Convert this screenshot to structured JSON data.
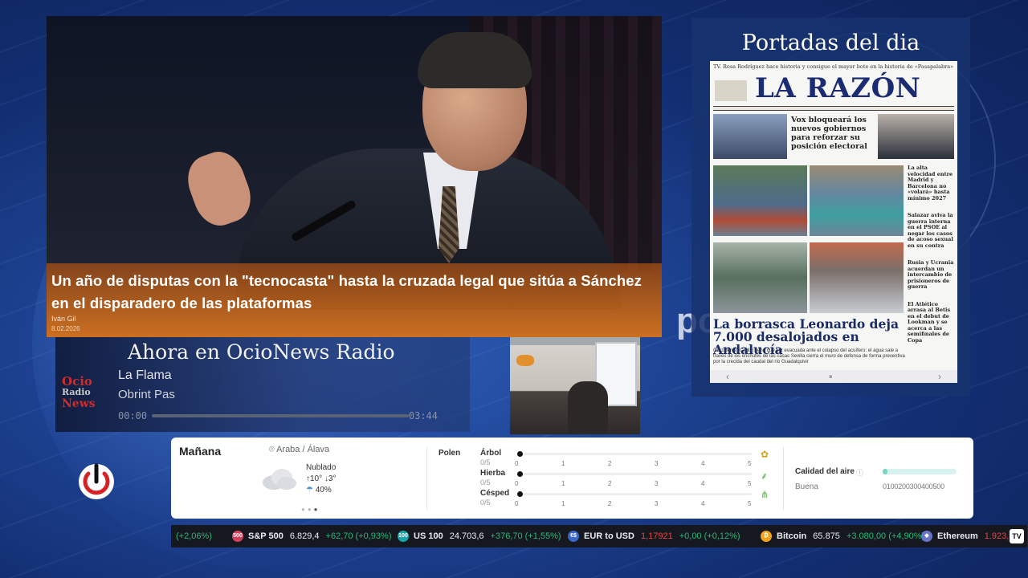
{
  "hero": {
    "headline": "Un año de disputas con la \"tecnocasta\" hasta la cruzada legal que sitúa a Sánchez en el disparadero de las plataformas",
    "author": "Iván Gil",
    "date": "8.02.2026"
  },
  "background": {
    "word": "po"
  },
  "radio": {
    "title": "Ahora en OcioNews Radio",
    "logo_line1": "Ocio",
    "logo_line2": "Radio",
    "logo_line3": "News",
    "song": "La Flama",
    "artist": "Obrint Pas",
    "time_current": "00:00",
    "time_total": "03:44"
  },
  "portadas": {
    "title": "Portadas del dia",
    "paper": {
      "top_line": "TV. Rosa Rodríguez hace historia y consigue el mayor bote en la historia de «Pasapalabra»",
      "masthead": "LA RAZÓN",
      "headline_secondary": "Vox bloqueará los nuevos gobiernos para reforzar su posición electoral",
      "side_items": [
        "La alta velocidad entre Madrid y Barcelona no «volará» hasta mínimo 2027",
        "Salazar aviva la guerra interna en el PSOE al negar los casos de acoso sexual en su contra",
        "Rusia y Ucrania acuerdan un intercambio de prisioneros de guerra",
        "El Atlético arrasa al Betis en el debut de Lookman y se acerca a las semifinales de Copa"
      ],
      "headline_main": "La borrasca Leonardo deja 7.000 desalojados en Andalucía",
      "sub_left": "Grazalema (Cádiz) tiene que ser evacuada ante el colapso del acuífero: el agua sale a través de los enchufes de las casas",
      "sub_right": "Sevilla cierra el muro de defensa de forma preventiva por la crecida del caudal del río Guadalquivir"
    }
  },
  "weather": {
    "day": "Mañana",
    "location": "Araba / Álava",
    "condition": "Nublado",
    "temp_max": "10°",
    "temp_min": "3°",
    "rain": "40%",
    "polen_label": "Polen",
    "polen": [
      {
        "name": "Árbol",
        "value": "0/5",
        "level": 0
      },
      {
        "name": "Hierba",
        "value": "0/5",
        "level": 0
      },
      {
        "name": "Césped",
        "value": "0/5",
        "level": 0
      }
    ],
    "polen_ticks": [
      "0",
      "1",
      "2",
      "3",
      "4",
      "5"
    ],
    "air_label": "Calidad del aire",
    "air_value": "Buena",
    "air_scale": "0100200300400500"
  },
  "ticker": {
    "items": [
      {
        "name": "",
        "price": "",
        "change": "(+2,06%)",
        "dir": "up"
      },
      {
        "icon": "500",
        "name": "S&P 500",
        "price": "6.829,4",
        "change": "+62,70 (+0,93%)",
        "dir": "up",
        "color": "#d43e5a"
      },
      {
        "icon": "100",
        "name": "US 100",
        "price": "24.703,6",
        "change": "+376,70 (+1,55%)",
        "dir": "up",
        "color": "#1aa3a8"
      },
      {
        "icon": "€$",
        "name": "EUR to USD",
        "price": "1,17921",
        "change": "+0,00 (+0,12%)",
        "dir": "mixed",
        "color": "#3a66c9"
      },
      {
        "icon": "₿",
        "name": "Bitcoin",
        "price": "65.875",
        "change": "+3.080,00 (+4,90%)",
        "dir": "up",
        "color": "#f2a21b"
      },
      {
        "icon": "◆",
        "name": "Ethereum",
        "price": "1.923,8",
        "change": "",
        "dir": "down",
        "color": "#6874c9"
      }
    ],
    "badge": "TV"
  }
}
